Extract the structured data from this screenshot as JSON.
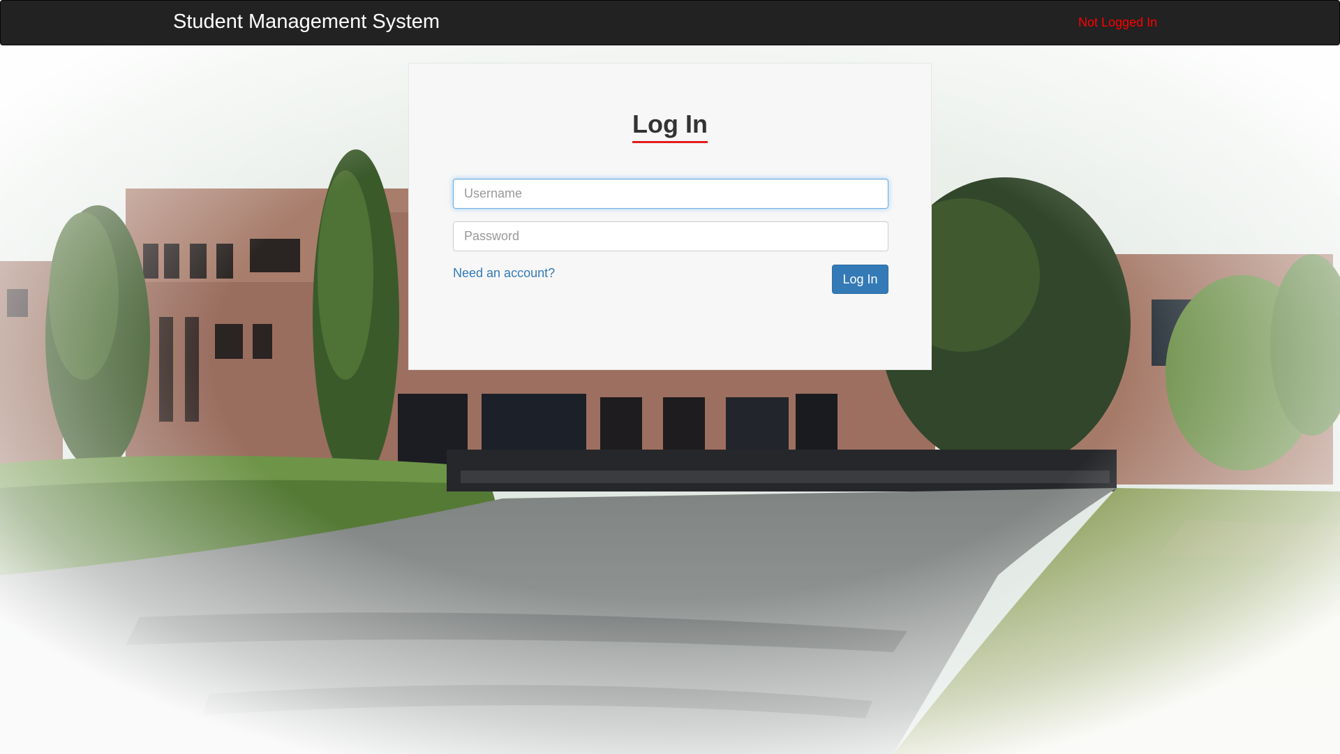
{
  "navbar": {
    "brand": "Student Management System",
    "status": "Not Logged In"
  },
  "colors": {
    "navbar_bg": "#222222",
    "status_red": "#ff0000",
    "link_blue": "#337ab7",
    "button_blue": "#337ab7",
    "title_underline": "#e31b1b",
    "panel_bg": "#f7f7f7"
  },
  "login": {
    "title": "Log In",
    "username_placeholder": "Username",
    "password_placeholder": "Password",
    "signup_link": "Need an account?",
    "submit_label": "Log In"
  }
}
